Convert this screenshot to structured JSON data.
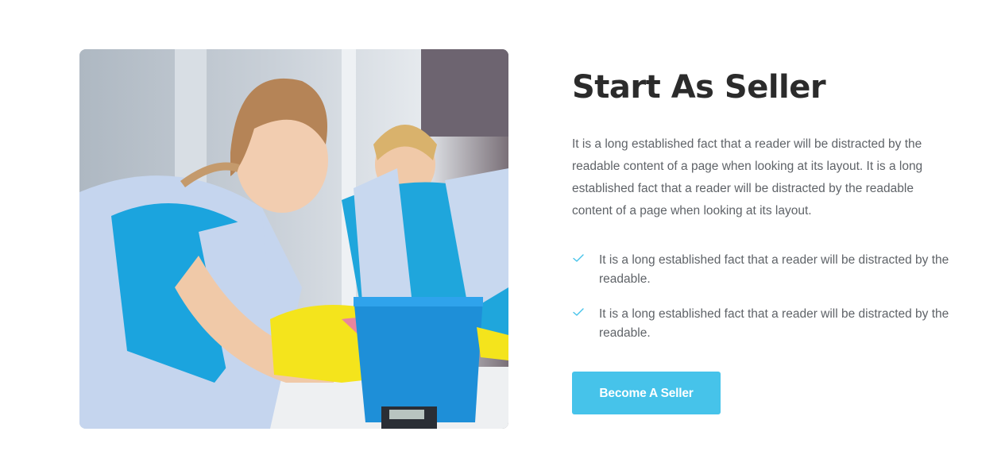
{
  "section": {
    "title": "Start As Seller",
    "description": "It is a long established fact that a reader will be distracted by the readable content of a page when looking at its layout. It is a long established fact that a reader will be distracted by the readable content of a page when looking at its layout.",
    "features": [
      {
        "icon": "check-icon",
        "text": "It is a long established fact that a reader will be distracted by the readable."
      },
      {
        "icon": "check-icon",
        "text": "It is a long established fact that a reader will be distracted by the readable."
      }
    ],
    "cta_label": "Become A Seller"
  },
  "colors": {
    "accent": "#46c3ea",
    "heading": "#2b2b2b",
    "body_text": "#5f6368",
    "check": "#46c3ea"
  }
}
